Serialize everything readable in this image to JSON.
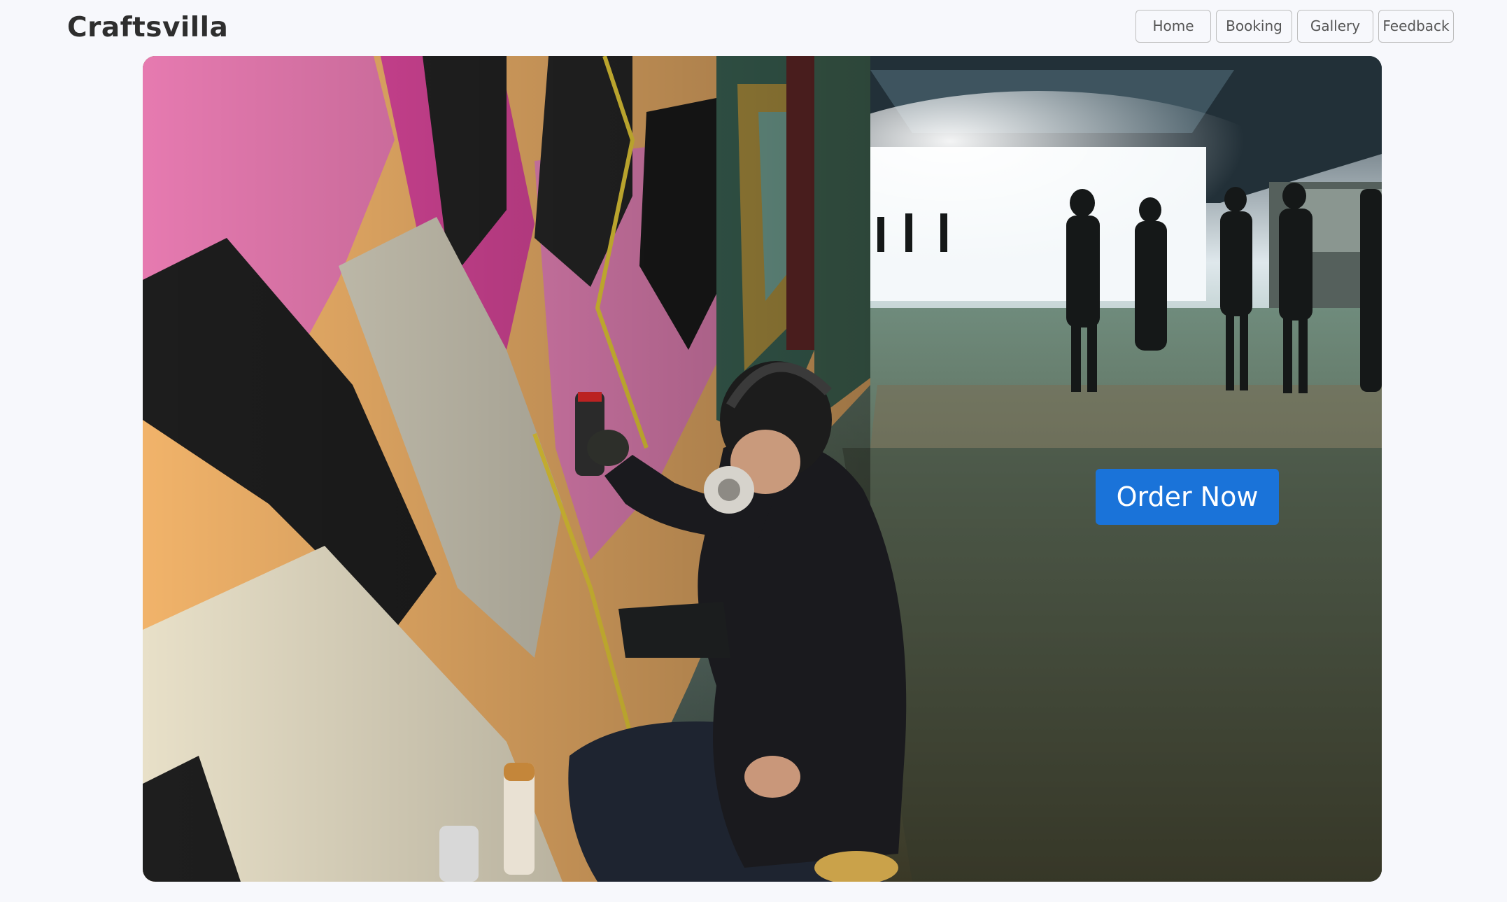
{
  "brand": {
    "name": "Craftsvilla"
  },
  "nav": {
    "items": [
      {
        "label": "Home"
      },
      {
        "label": "Booking"
      },
      {
        "label": "Gallery"
      },
      {
        "label": "Feedback"
      }
    ]
  },
  "hero": {
    "cta_label": "Order Now",
    "cta_color": "#1a73d9",
    "image": "street-artist-spray-painting-graffiti-wall-in-tunnel"
  },
  "colors": {
    "background": "#f7f8fc",
    "brand_text": "#2e2e2e",
    "nav_border": "#bdbdbd"
  }
}
